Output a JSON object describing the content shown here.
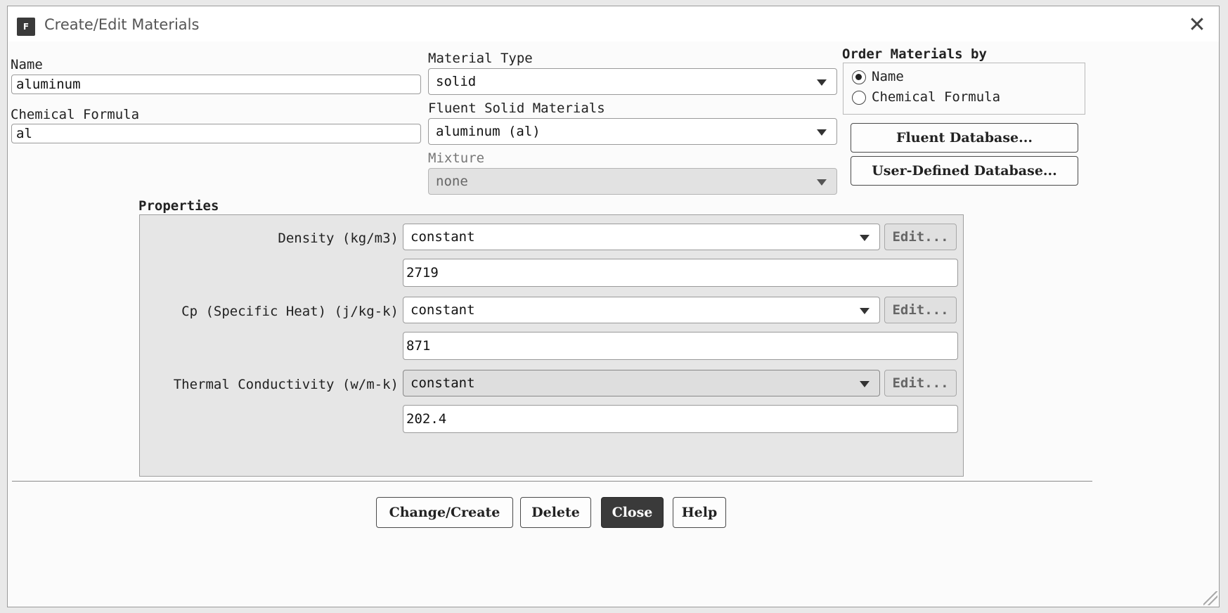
{
  "window": {
    "title": "Create/Edit Materials",
    "icon_letter": "F"
  },
  "name": {
    "label": "Name",
    "value": "aluminum"
  },
  "chemical_formula": {
    "label": "Chemical Formula",
    "value": "al"
  },
  "material_type": {
    "label": "Material Type",
    "value": "solid"
  },
  "fluent_solid_materials": {
    "label": "Fluent Solid Materials",
    "value": "aluminum (al)"
  },
  "mixture": {
    "label": "Mixture",
    "value": "none"
  },
  "order_by": {
    "label": "Order Materials by",
    "options": [
      {
        "label": "Name",
        "checked": true
      },
      {
        "label": "Chemical Formula",
        "checked": false
      }
    ]
  },
  "database_buttons": {
    "fluent": "Fluent Database...",
    "user_defined": "User-Defined Database..."
  },
  "properties": {
    "label": "Properties",
    "rows": [
      {
        "label": "Density (kg/m3)",
        "method": "constant",
        "edit": "Edit...",
        "value": "2719"
      },
      {
        "label": "Cp (Specific Heat) (j/kg-k)",
        "method": "constant",
        "edit": "Edit...",
        "value": "871"
      },
      {
        "label": "Thermal Conductivity (w/m-k)",
        "method": "constant",
        "edit": "Edit...",
        "value": "202.4"
      }
    ]
  },
  "footer": {
    "change_create": "Change/Create",
    "delete": "Delete",
    "close": "Close",
    "help": "Help"
  },
  "colors": {
    "primary_button": "#3a3a3a",
    "panel_background": "#e6e6e6",
    "window_background": "#fbfbfb"
  }
}
